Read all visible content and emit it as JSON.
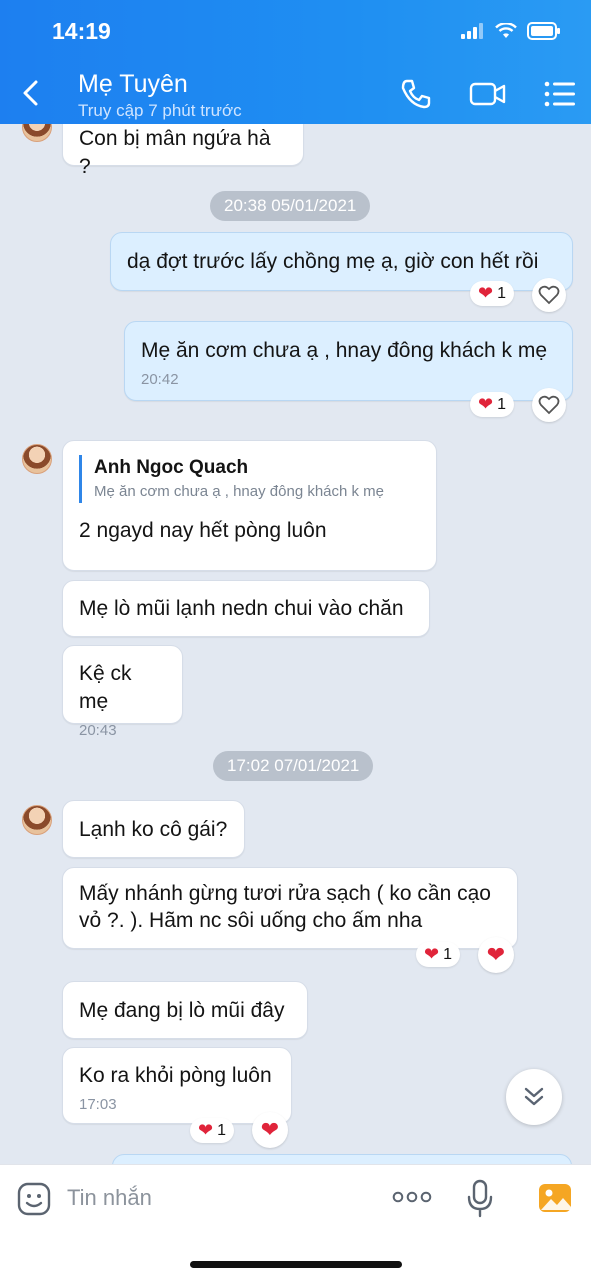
{
  "status": {
    "time": "14:19"
  },
  "header": {
    "name": "Mẹ Tuyên",
    "subtitle": "Truy cập 7 phút trước"
  },
  "messages": {
    "m0": "Con bị mân ngứa hà ?",
    "d1": "20:38 05/01/2021",
    "m1": "dạ đợt trước lấy chồng mẹ ạ, giờ con hết rồi",
    "m1_react": "1",
    "m2": "Mẹ ăn cơm chưa ạ , hnay đông khách k mẹ",
    "m2_time": "20:42",
    "m2_react": "1",
    "m3_quote_name": "Anh Ngoc Quach",
    "m3_quote_text": "Mẹ ăn cơm chưa ạ , hnay đông khách k mẹ",
    "m3": "2 ngayd nay hết pòng luôn",
    "m4": "Mẹ lò mũi lạnh nedn chui vào chăn",
    "m5": "Kệ ck mẹ",
    "m5_time": "20:43",
    "d2": "17:02 07/01/2021",
    "m6": "Lạnh ko cô gái?",
    "m7_l1": "Mấy nhánh gừng tươi rửa sạch ( ko cần cạo",
    "m7_l2": "vỏ ?. ). Hãm nc sôi uống cho ấm nha",
    "m7_react": "1",
    "m8": "Mẹ đang bị lò mũi đây",
    "m9": "Ko ra khỏi pòng luôn",
    "m9_time": "17:03",
    "m9_react": "1"
  },
  "input": {
    "placeholder": "Tin nhắn"
  },
  "colors": {
    "header": "#1d7ff0",
    "bubble_me": "#dcefff",
    "heart": "#e0243a"
  }
}
